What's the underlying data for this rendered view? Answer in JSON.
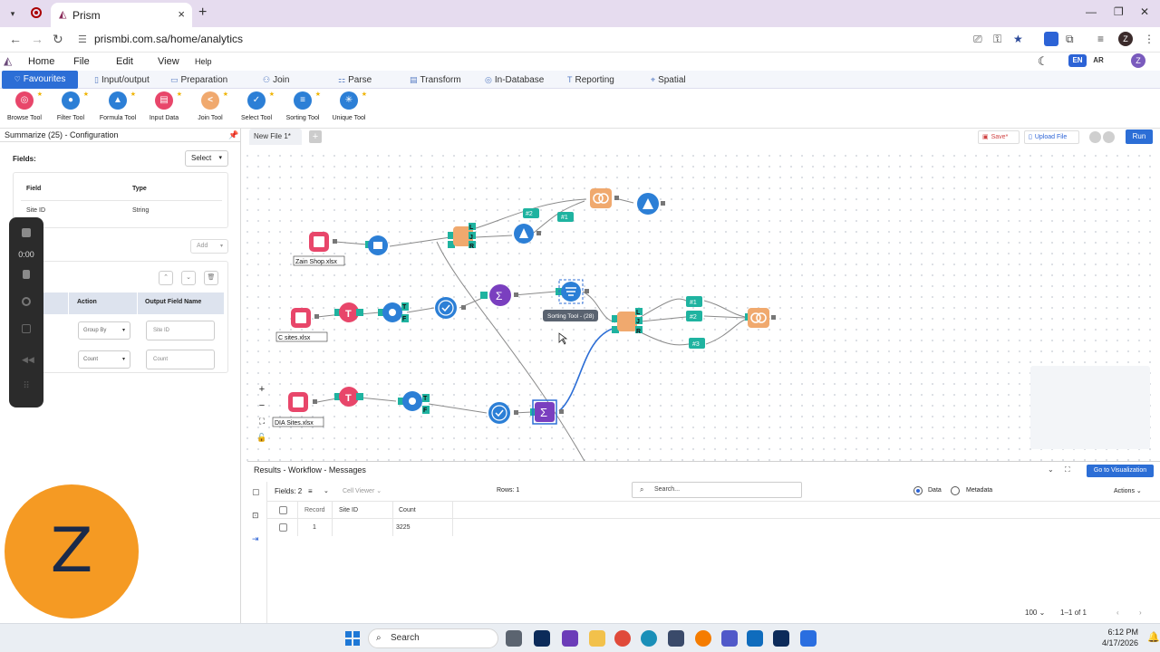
{
  "browser": {
    "tab_title": "Prism",
    "url": "prismbi.com.sa/home/analytics",
    "profile_initial": "Z"
  },
  "app_menu": {
    "items": [
      "Home",
      "File",
      "Edit",
      "View",
      "Help"
    ],
    "lang_en": "EN",
    "lang_ar": "AR",
    "user_initial": "Z"
  },
  "categories": [
    "Favourites",
    "Input/output",
    "Preparation",
    "Join",
    "Parse",
    "Transform",
    "In-Database",
    "Reporting",
    "Spatial"
  ],
  "tools": [
    {
      "label": "Browse Tool",
      "color": "#e8466a",
      "icon": "browse-icon"
    },
    {
      "label": "Filter Tool",
      "color": "#2c7fd6",
      "icon": "filter-icon"
    },
    {
      "label": "Formula Tool",
      "color": "#2c7fd6",
      "icon": "formula-icon"
    },
    {
      "label": "Input Data",
      "color": "#e8466a",
      "icon": "input-data-icon"
    },
    {
      "label": "Join Tool",
      "color": "#f0a96e",
      "icon": "join-icon"
    },
    {
      "label": "Select Tool",
      "color": "#2c7fd6",
      "icon": "select-icon"
    },
    {
      "label": "Sorting Tool",
      "color": "#2c7fd6",
      "icon": "sort-icon"
    },
    {
      "label": "Unique Tool",
      "color": "#2c7fd6",
      "icon": "unique-icon"
    }
  ],
  "config": {
    "title": "Summarize (25) - Configuration",
    "fields_label": "Fields:",
    "select_label": "Select",
    "field_col": "Field",
    "type_col": "Type",
    "field_value": "Site ID",
    "type_value": "String",
    "add_label": "Add",
    "action_col": "Action",
    "output_col": "Output Field Name",
    "rows": [
      {
        "action": "Group By",
        "output": "Site ID"
      },
      {
        "action": "Count",
        "output": "Count"
      }
    ]
  },
  "recorder": {
    "time": "0:00"
  },
  "overlay_initial": "Z",
  "canvas": {
    "file_tab": "New File 1*",
    "save_label": "Save*",
    "upload_label": "Upload File",
    "run_label": "Run",
    "file_labels": [
      "Zain Shop.xlsx",
      "C sites.xlsx",
      "DIA Sites.xlsx"
    ],
    "tooltip": "Sorting Tool - (28)",
    "badges": [
      "#2",
      "#1",
      "#1",
      "#2",
      "#3"
    ],
    "join_letters": [
      "L",
      "J",
      "R"
    ],
    "filter_letters": [
      "T",
      "F"
    ]
  },
  "results": {
    "title": "Results - Workflow - Messages",
    "goto_label": "Go to Visualization",
    "fields": "Fields: 2",
    "cell_viewer": "Cell Viewer",
    "rows": "Rows: 1",
    "search_placeholder": "Search...",
    "data_label": "Data",
    "metadata_label": "Metadata",
    "actions_label": "Actions",
    "columns": [
      "Record",
      "Site ID",
      "Count"
    ],
    "data": [
      {
        "record": "1",
        "site_id": "",
        "count": "3225"
      }
    ],
    "page_size": "100",
    "page_info": "1–1 of 1"
  },
  "taskbar": {
    "search_label": "Search",
    "time": "6:12 PM",
    "date": "4/17/2026"
  }
}
